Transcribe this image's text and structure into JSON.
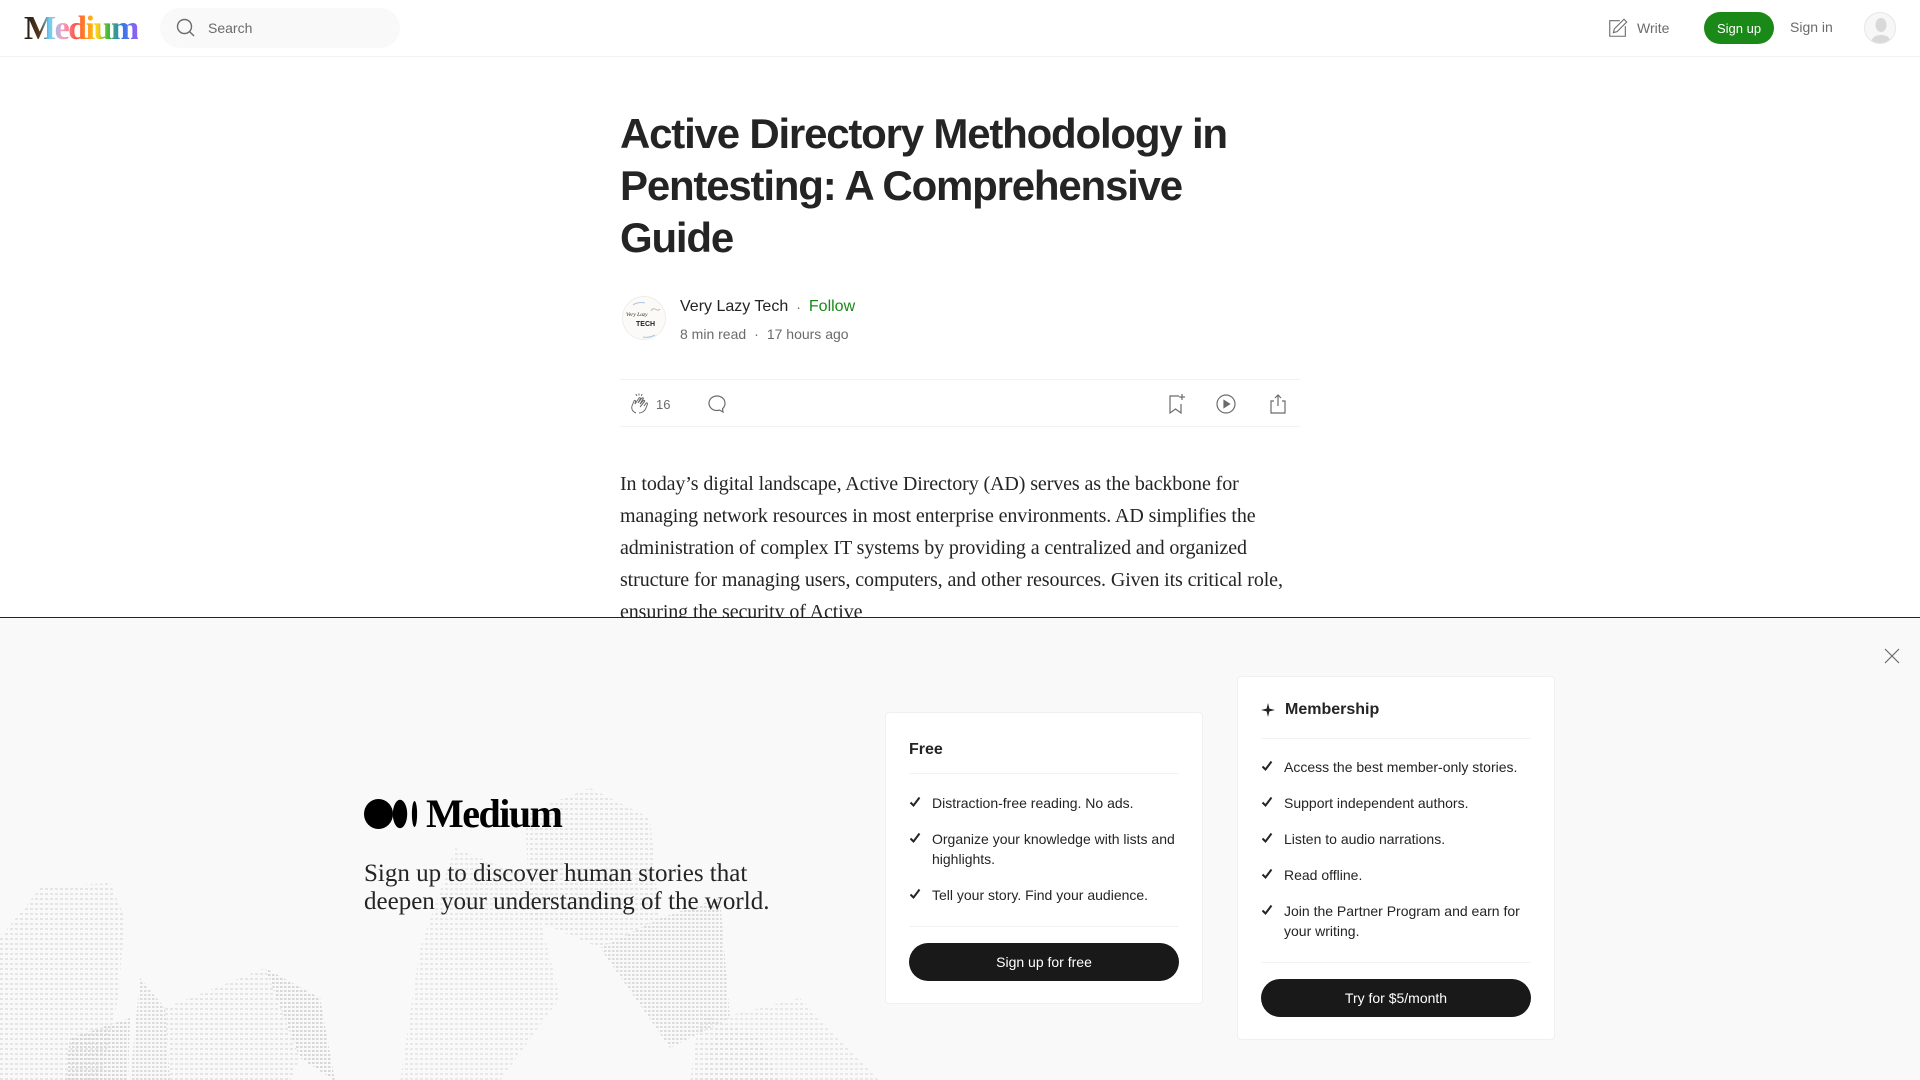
{
  "header": {
    "logo_text": "Medium",
    "search": {
      "placeholder": "Search",
      "value": ""
    },
    "write_label": "Write",
    "signup_label": "Sign up",
    "signin_label": "Sign in",
    "accent_color": "#1a8917"
  },
  "article": {
    "title": "Active Directory Methodology in Pentesting: A Comprehensive Guide",
    "author": {
      "name": "Very Lazy Tech",
      "avatar_text_top": "Very Lazy",
      "avatar_text_bottom": "TECH",
      "follow_label": "Follow"
    },
    "read_time": "8 min read",
    "published": "17 hours ago",
    "separator": "·",
    "actions": {
      "clap_count": "16",
      "icons": [
        "clap-icon",
        "comment-icon",
        "bookmark-add-icon",
        "listen-play-icon",
        "share-icon"
      ]
    },
    "body": "In today’s digital landscape, Active Directory (AD) serves as the backbone for managing network resources in most enterprise environments. AD simplifies the administration of complex IT systems by providing a centralized and organized structure for managing users, computers, and other resources. Given its critical role, ensuring the security of Active"
  },
  "overlay": {
    "brand": "Medium",
    "tagline": "Sign up to discover human stories that deepen your understanding of the world.",
    "free_plan": {
      "title": "Free",
      "features": [
        "Distraction-free reading. No ads.",
        "Organize your knowledge with lists and highlights.",
        "Tell your story. Find your audience."
      ],
      "cta": "Sign up for free"
    },
    "membership_plan": {
      "title": "Membership",
      "features": [
        "Access the best member-only stories.",
        "Support independent authors.",
        "Listen to audio narrations.",
        "Read offline.",
        "Join the Partner Program and earn for your writing."
      ],
      "cta": "Try for $5/month"
    }
  }
}
